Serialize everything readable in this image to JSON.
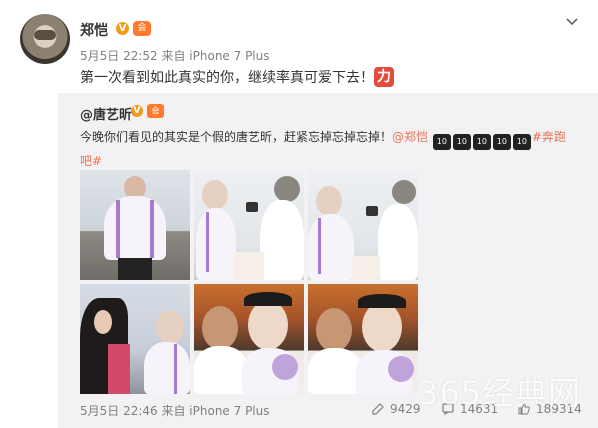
{
  "author": {
    "name": "郑恺",
    "verified_mark": "V",
    "member_mark": "会",
    "meta": "5月5日 22:52 来自 iPhone 7 Plus",
    "text": "第一次看到如此真实的你，继续率真可爱下去！",
    "emoji_label": "力"
  },
  "repost": {
    "name": "@唐艺昕",
    "verified_mark": "V",
    "member_mark": "会",
    "text_main": "今晚你们看见的其实是个假的唐艺昕，赶紧忘掉忘掉忘掉！",
    "mention": "@郑恺",
    "emoji": [
      "10",
      "10",
      "10",
      "10",
      "10"
    ],
    "hashtag_part1": "#奔跑",
    "hashtag_part2": "吧#",
    "meta": "5月5日 22:46 来自 iPhone 7 Plus",
    "stats": {
      "repost_count": "9429",
      "comment_count": "14631",
      "like_count": "189314"
    },
    "photos": [
      {
        "scene": "seaside-portrait"
      },
      {
        "scene": "phone-photo"
      },
      {
        "scene": "phone-photo"
      },
      {
        "scene": "hair-closeup"
      },
      {
        "scene": "selfie"
      },
      {
        "scene": "selfie"
      }
    ]
  },
  "icons": {
    "menu": "chevron-down-icon",
    "repost": "repost-icon",
    "comment": "comment-icon",
    "like": "like-icon"
  },
  "colors": {
    "link": "#eb7350",
    "verified": "#f39a1c",
    "background_repost": "#f2f2f5",
    "outfit_stripe": "#a57bd2"
  },
  "watermark": "365经典网"
}
